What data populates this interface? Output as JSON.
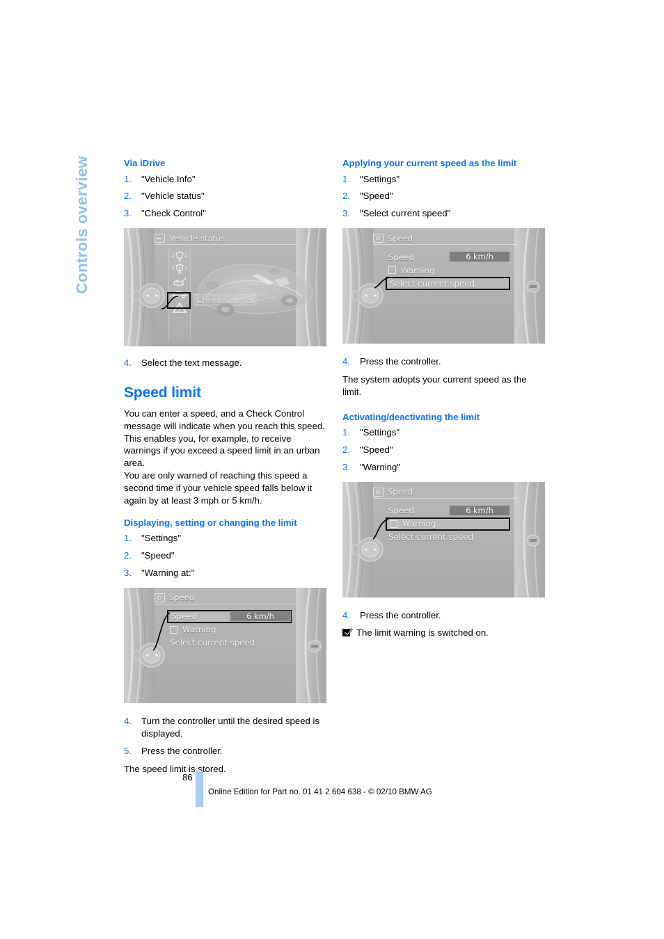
{
  "chapter_tab": {
    "label": "Controls overview"
  },
  "colors": {
    "heading_blue": "#0c72ef",
    "tab_blue": "#8fbff4",
    "page_bar_blue": "#a9cef6"
  },
  "left_column": {
    "subheading_1": "Via iDrive",
    "steps_1": [
      {
        "num": "1.",
        "text": "\"Vehicle Info\""
      },
      {
        "num": "2.",
        "text": "\"Vehicle status\""
      },
      {
        "num": "3.",
        "text": "\"Check Control\""
      }
    ],
    "figure_1": {
      "caption_icon": "screen-icon",
      "title": "Vehicle status",
      "tooltip": "Check Control",
      "icons": [
        "bulb-front-icon",
        "bulb-rear-icon",
        "oil-can-icon",
        "car-icon",
        "warning-triangle-icon"
      ],
      "highlighted_icon": "warning-triangle-icon"
    },
    "steps_1_cont": [
      {
        "num": "4.",
        "text": "Select the text message."
      }
    ],
    "section_title": "Speed limit",
    "intro_paragraph_1": "You can enter a speed, and a Check Control message will indicate when you reach this speed. This enables you, for example, to receive warnings if you exceed a speed limit in an urban area.",
    "intro_paragraph_2": "You are only warned of reaching this speed a second time if your vehicle speed falls below it again by at least 3 mph or 5 km/h.",
    "subheading_2": "Displaying, setting or changing the limit",
    "steps_2": [
      {
        "num": "1.",
        "text": "\"Settings\""
      },
      {
        "num": "2.",
        "text": "\"Speed\""
      },
      {
        "num": "3.",
        "text": "\"Warning at:\""
      }
    ],
    "figure_2": {
      "title": "Speed",
      "rows": [
        {
          "label": "Speed",
          "value": "6 km/h",
          "selected": true,
          "checkbox": false
        },
        {
          "label": "Warning",
          "value": "",
          "selected": false,
          "checkbox": true
        },
        {
          "label": "Select current speed",
          "value": "",
          "selected": false,
          "checkbox": false
        }
      ]
    },
    "steps_2_cont": [
      {
        "num": "4.",
        "text": "Turn the controller until the desired speed is displayed."
      },
      {
        "num": "5.",
        "text": "Press the controller."
      }
    ],
    "closing_text": "The speed limit is stored."
  },
  "right_column": {
    "subheading_1": "Applying your current speed as the limit",
    "steps_1": [
      {
        "num": "1.",
        "text": "\"Settings\""
      },
      {
        "num": "2.",
        "text": "\"Speed\""
      },
      {
        "num": "3.",
        "text": "\"Select current speed\""
      }
    ],
    "figure_1": {
      "title": "Speed",
      "rows": [
        {
          "label": "Speed",
          "value": "6 km/h",
          "selected": false,
          "checkbox": false
        },
        {
          "label": "Warning",
          "value": "",
          "selected": false,
          "checkbox": true
        },
        {
          "label": "Select current speed",
          "value": "",
          "selected": true,
          "checkbox": false
        }
      ]
    },
    "steps_1_cont": [
      {
        "num": "4.",
        "text": "Press the controller."
      }
    ],
    "result_text_1": "The system adopts your current speed as the limit.",
    "subheading_2": "Activating/deactivating the limit",
    "steps_2": [
      {
        "num": "1.",
        "text": "\"Settings\""
      },
      {
        "num": "2.",
        "text": "\"Speed\""
      },
      {
        "num": "3.",
        "text": "\"Warning\""
      }
    ],
    "figure_2": {
      "title": "Speed",
      "rows": [
        {
          "label": "Speed",
          "value": "6 km/h",
          "selected": false,
          "checkbox": false
        },
        {
          "label": "Warning",
          "value": "",
          "selected": true,
          "checkbox": true
        },
        {
          "label": "Select current speed",
          "value": "",
          "selected": false,
          "checkbox": false
        }
      ]
    },
    "steps_2_cont": [
      {
        "num": "4.",
        "text": "Press the controller."
      }
    ],
    "note_text": "The limit warning is switched on."
  },
  "footer": {
    "page_number": "86",
    "text": "Online Edition for Part no. 01 41 2 604 638 - © 02/10 BMW AG"
  }
}
